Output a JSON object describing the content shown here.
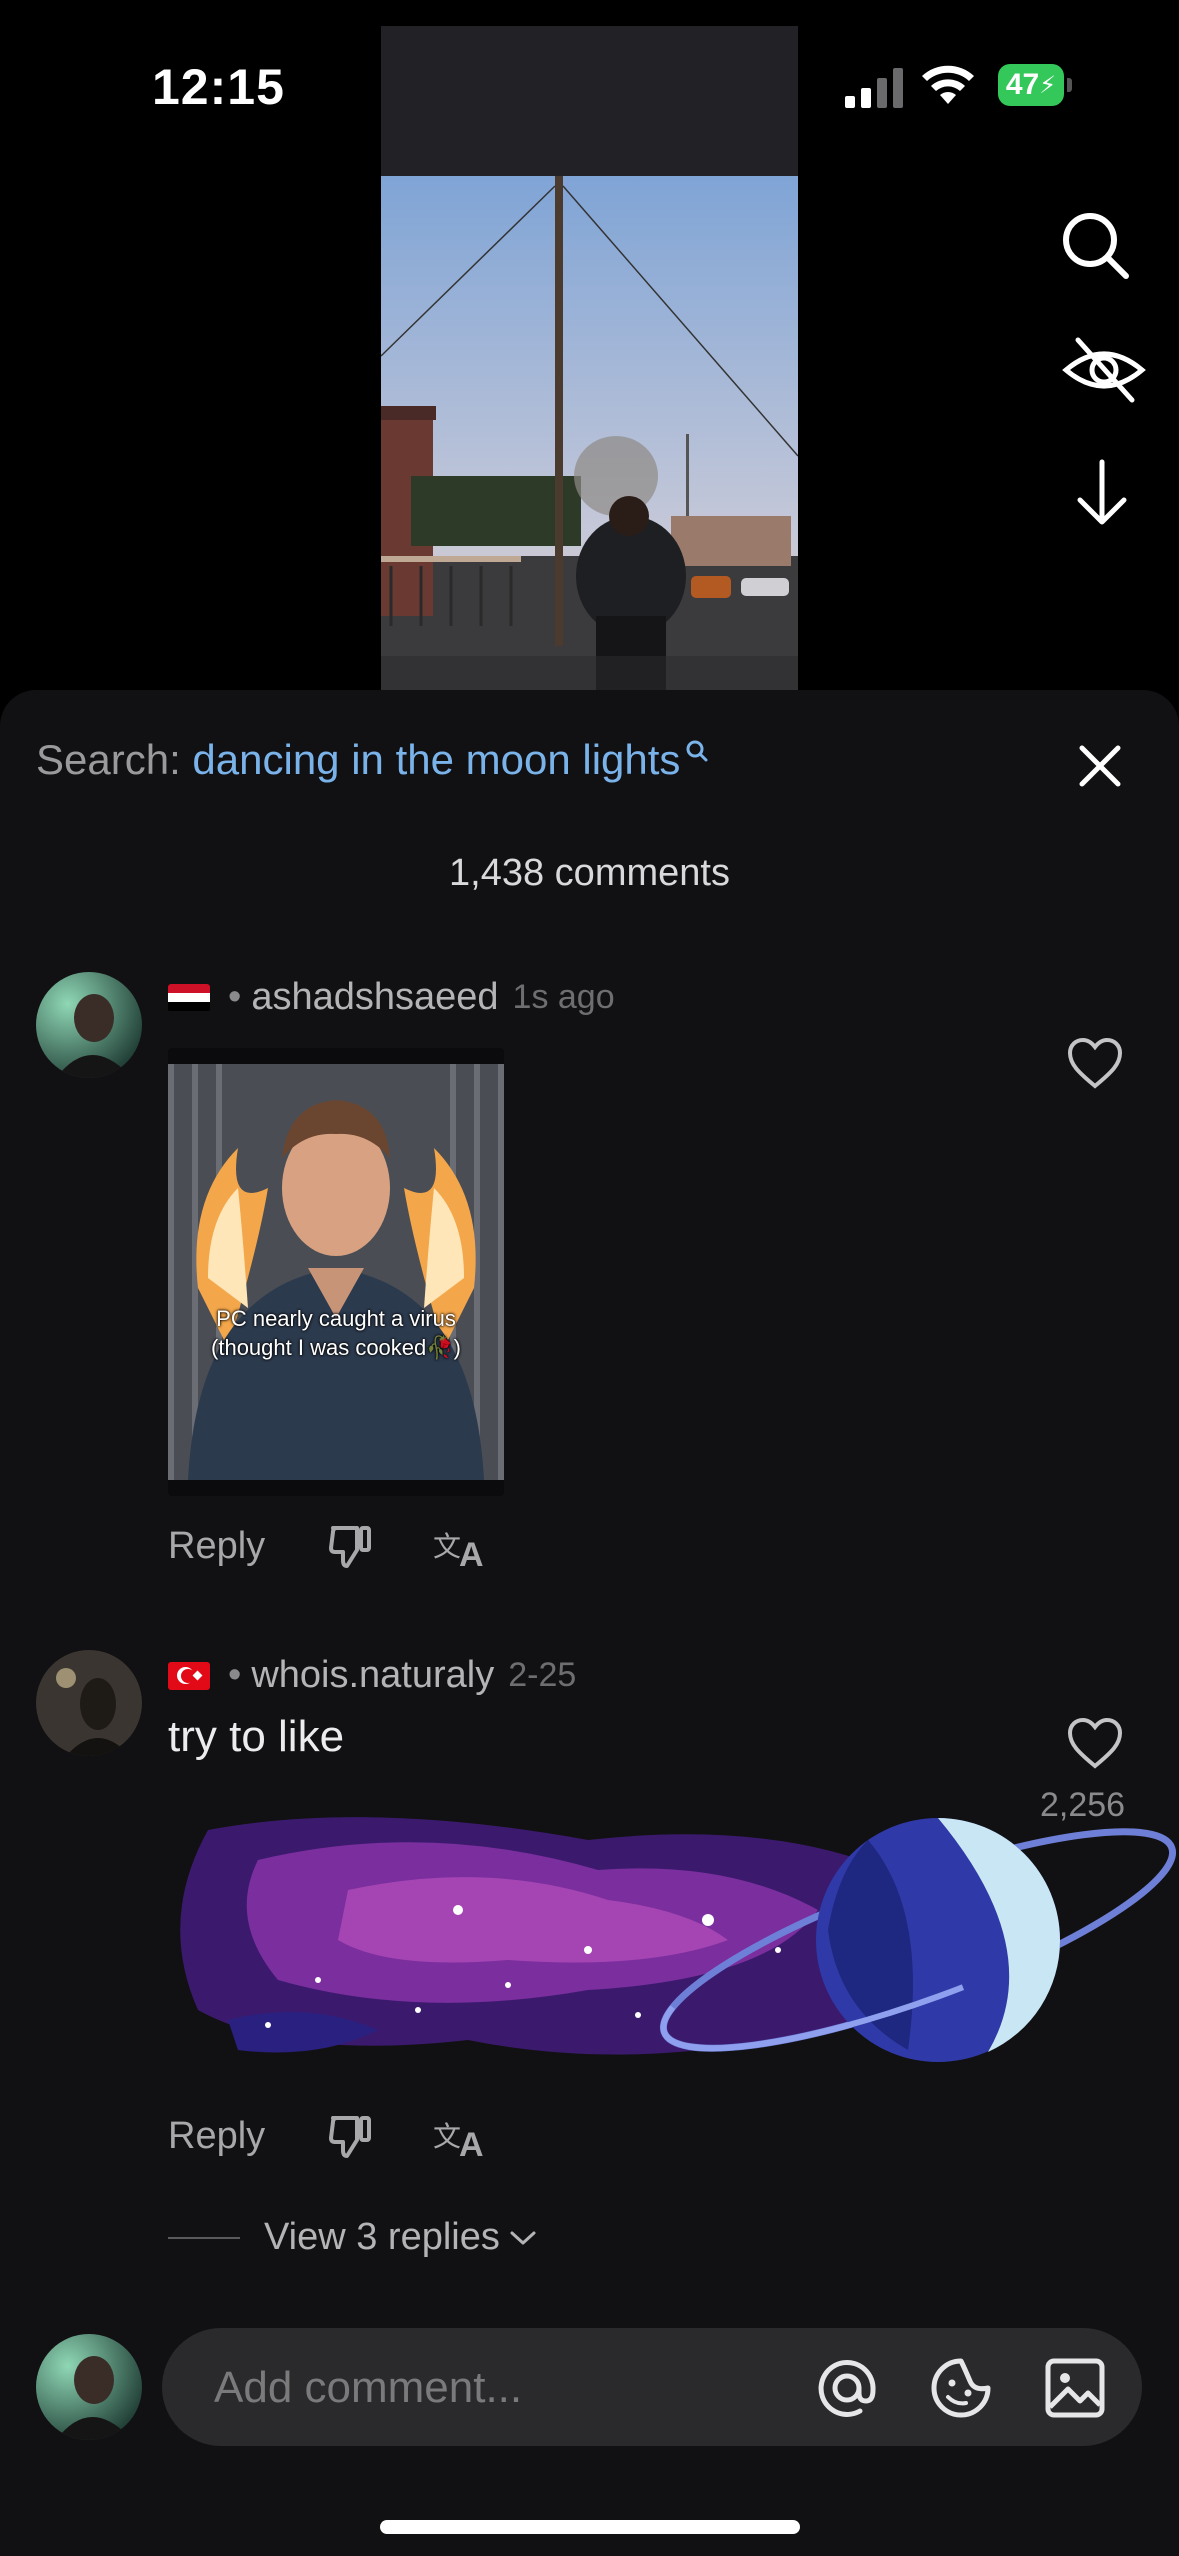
{
  "status_bar": {
    "time": "12:15",
    "battery": "47"
  },
  "video": {
    "alt": "video preview"
  },
  "search": {
    "prefix": "Search:",
    "query": "dancing in the moon lights"
  },
  "comments_count": "1,438 comments",
  "comments": [
    {
      "username": "ashadshsaeed",
      "flag": "iraq-flag",
      "time": "1s ago",
      "gif_caption_1": "PC nearly caught a virus",
      "gif_caption_2": "(thought I was cooked🥀)",
      "reply_label": "Reply"
    },
    {
      "username": "whois.naturaly",
      "flag": "turkey-flag",
      "time": "2-25",
      "text": "try to like",
      "likes": "2,256",
      "reply_label": "Reply",
      "view_replies": "View 3 replies"
    }
  ],
  "composer": {
    "placeholder": "Add comment..."
  },
  "colors": {
    "accent": "#7ab3ea",
    "sheet": "#111113",
    "battery": "#34c759"
  }
}
